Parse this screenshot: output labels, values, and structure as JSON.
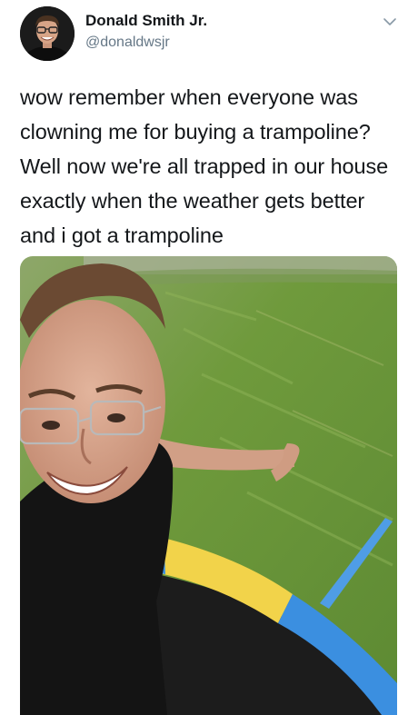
{
  "author": {
    "display_name": "Donald Smith Jr.",
    "handle": "@donaldwsjr",
    "avatar_icon": "profile-photo"
  },
  "tweet": {
    "text": "wow remember when everyone was clowning me for buying a trampoline? Well now we're all trapped in our house exactly when the weather gets better and i got a trampoline"
  },
  "media": {
    "type": "photo",
    "icon": "selfie-photo"
  },
  "menu": {
    "icon": "chevron-down-icon"
  },
  "colors": {
    "text": "#14171a",
    "secondary_text": "#657786",
    "grass": "#6f9a3c",
    "trampoline_pad_yellow": "#f2d34a",
    "trampoline_pad_blue": "#3b8fe0"
  }
}
